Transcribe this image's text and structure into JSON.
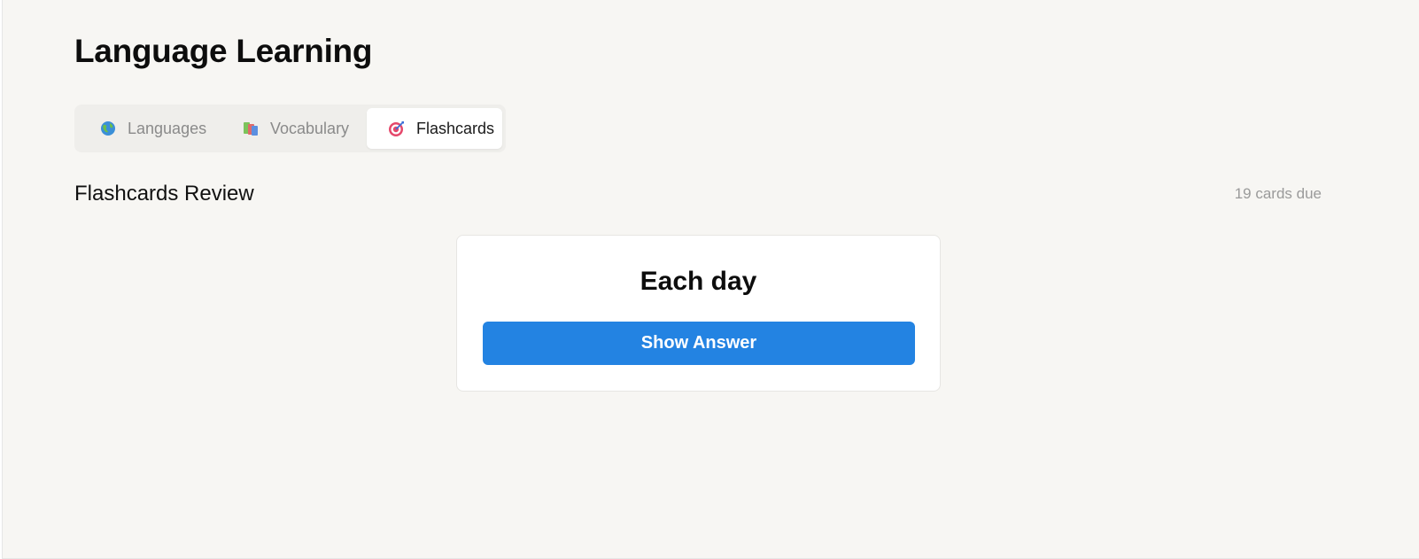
{
  "app": {
    "title": "Language Learning"
  },
  "tabs": [
    {
      "label": "Languages",
      "icon": "globe-icon",
      "active": false
    },
    {
      "label": "Vocabulary",
      "icon": "books-icon",
      "active": false
    },
    {
      "label": "Flashcards",
      "icon": "target-icon",
      "active": true
    }
  ],
  "review": {
    "title": "Flashcards Review",
    "due_text": "19 cards due"
  },
  "card": {
    "prompt": "Each day",
    "button_label": "Show Answer"
  },
  "colors": {
    "background": "#f7f6f3",
    "accent": "#2383e2",
    "muted_text": "#8a8a8a"
  }
}
